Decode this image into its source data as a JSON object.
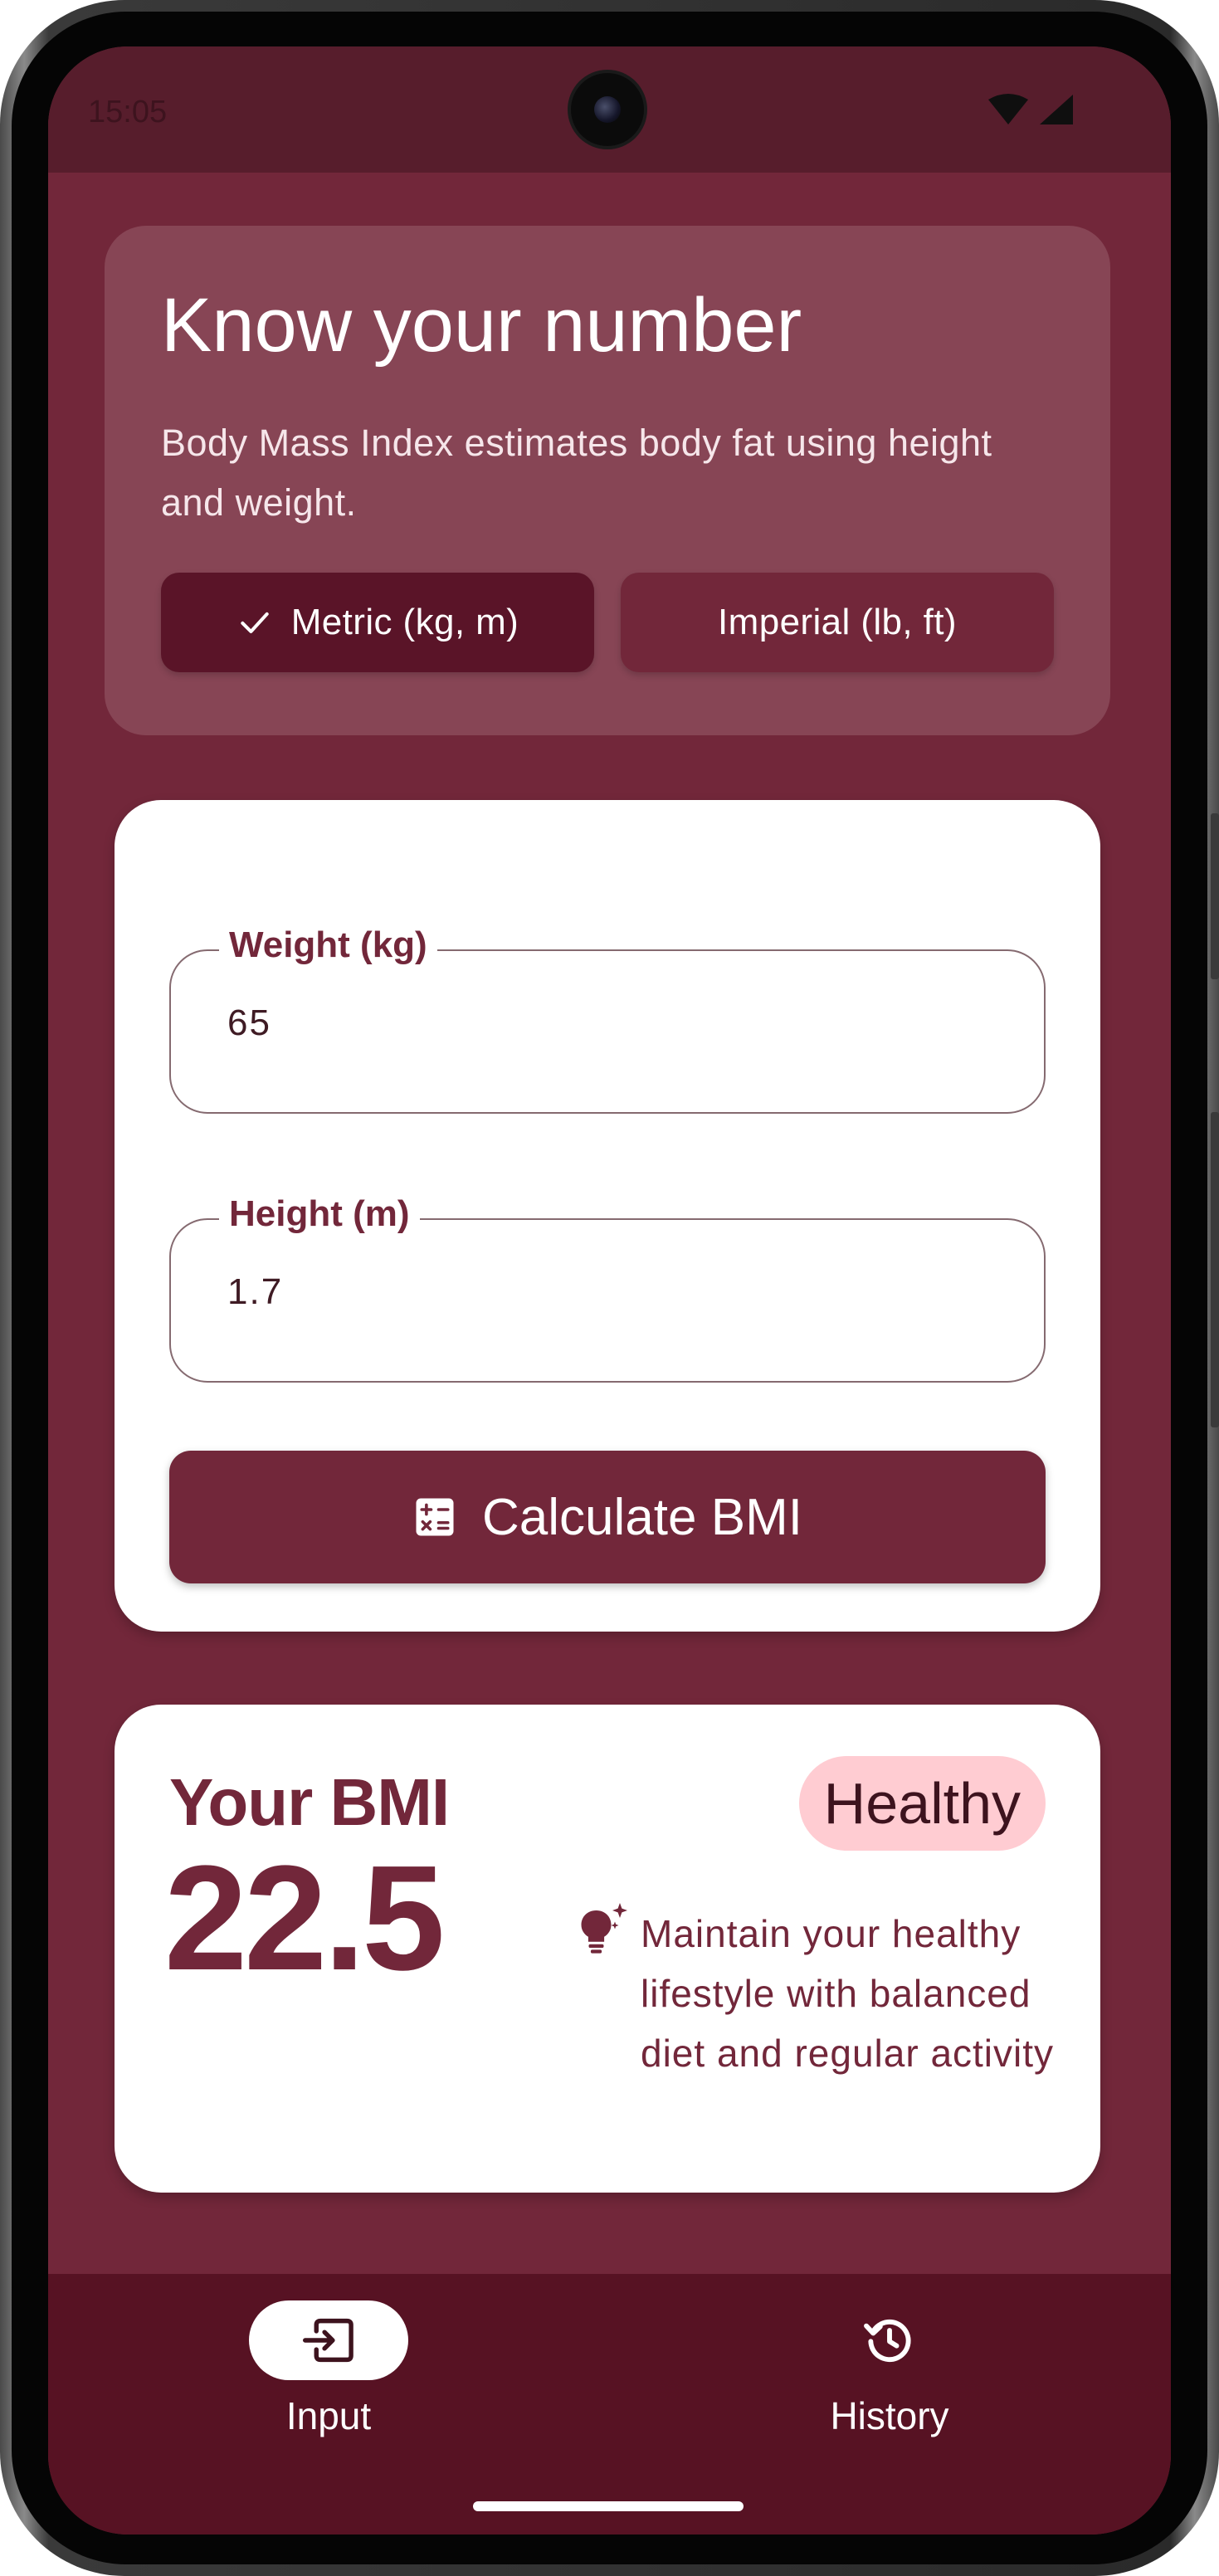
{
  "status_bar": {
    "time": "15:05"
  },
  "intro": {
    "title": "Know your number",
    "description": "Body Mass Index estimates body fat using height and weight.",
    "unit_options": [
      {
        "label": "Metric (kg, m)",
        "selected": true
      },
      {
        "label": "Imperial (lb, ft)",
        "selected": false
      }
    ]
  },
  "form": {
    "weight_label": "Weight (kg)",
    "weight_value": "65",
    "height_label": "Height (m)",
    "height_value": "1.7",
    "calculate_label": "Calculate BMI"
  },
  "result": {
    "title": "Your BMI",
    "value": "22.5",
    "status": "Healthy",
    "tip": "Maintain your healthy lifestyle with balanced diet and regular activity"
  },
  "nav": {
    "items": [
      {
        "label": "Input",
        "icon": "input-icon",
        "active": true
      },
      {
        "label": "History",
        "icon": "history-icon",
        "active": false
      }
    ]
  },
  "colors": {
    "primary": "#72273a",
    "surface_dark": "#571d2c",
    "badge_bg": "#ffccd2"
  }
}
